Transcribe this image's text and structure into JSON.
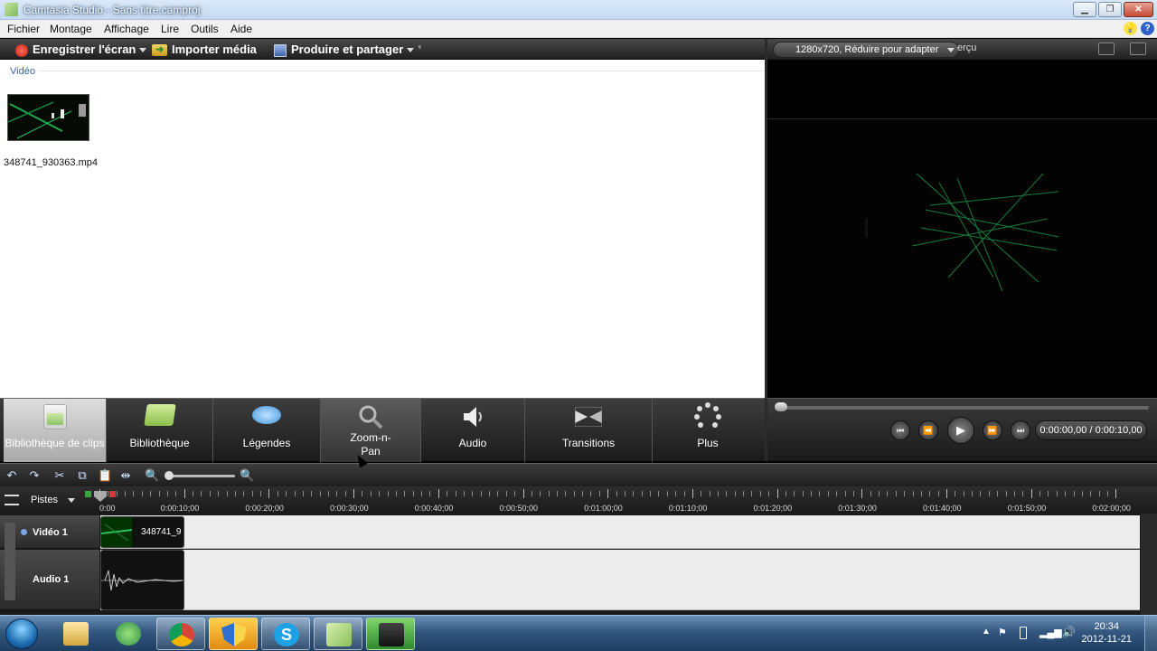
{
  "window": {
    "title": "Camtasia Studio - Sans titre.camproj"
  },
  "menu": {
    "items": [
      "Fichier",
      "Montage",
      "Affichage",
      "Lire",
      "Outils",
      "Aide"
    ]
  },
  "toolbar": {
    "record_label": "Enregistrer l'écran",
    "import_label": "Importer média",
    "produce_label": "Produire et partager"
  },
  "clip_bin": {
    "section_label": "Vidéo",
    "media_file_name": "348741_930363.mp4"
  },
  "tabs": [
    {
      "label": "Bibliothèque de clips",
      "icon": "clip-bin-icon",
      "state": "active"
    },
    {
      "label": "Bibliothèque",
      "icon": "library-folder-icon",
      "state": "normal"
    },
    {
      "label": "Légendes",
      "icon": "speech-bubble-icon",
      "state": "normal"
    },
    {
      "label": "Zoom-n-Pan",
      "icon": "magnifier-icon",
      "state": "hover"
    },
    {
      "label": "Audio",
      "icon": "speaker-icon",
      "state": "normal"
    },
    {
      "label": "Transitions",
      "icon": "transitions-icon",
      "state": "normal"
    },
    {
      "label": "Plus",
      "icon": "more-dots-icon",
      "state": "normal"
    }
  ],
  "preview": {
    "resolution_select": "1280x720, Réduire pour adapter",
    "partial_word": "erçu",
    "time_display": "0:00:00,00 / 0:00:10,00",
    "scrub_position": 0
  },
  "timeline": {
    "tracks_label": "Pistes",
    "ruler_labels": [
      "0:00",
      "0:00:10;00",
      "0:00:20;00",
      "0:00:30;00",
      "0:00:40;00",
      "0:00:50;00",
      "0:01:00;00",
      "0:01:10;00",
      "0:01:20;00",
      "0:01:30;00",
      "0:01:40;00",
      "0:01:50;00",
      "0:02:00;00"
    ],
    "video_track_label": "Vidéo 1",
    "audio_track_label": "Audio 1",
    "video_clip_label": "348741_9"
  },
  "taskbar": {
    "apps": [
      "windows-explorer-icon",
      "network-icon",
      "chrome-icon",
      "security-shield-icon",
      "skype-icon",
      "camtasia-icon",
      "camtasia-recorder-icon"
    ],
    "clock_time": "20:34",
    "clock_date": "2012-11-21"
  },
  "colors": {
    "dark_toolbar": "#2b2b2b",
    "timeline_track_bg": "#ececec",
    "taskbar": "#33577f",
    "record_red": "#d9302a"
  }
}
